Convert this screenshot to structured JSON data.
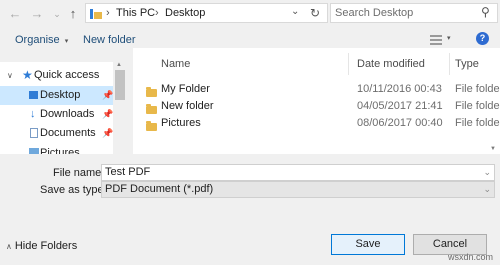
{
  "address": {
    "crumbs": [
      "This PC",
      "Desktop"
    ],
    "separator": "›",
    "search_placeholder": "Search Desktop"
  },
  "toolbar": {
    "organise_label": "Organise",
    "new_folder_label": "New folder"
  },
  "nav_pane": {
    "items": [
      {
        "label": "Quick access"
      },
      {
        "label": "Desktop"
      },
      {
        "label": "Downloads"
      },
      {
        "label": "Documents"
      },
      {
        "label": "Pictures"
      }
    ]
  },
  "file_list": {
    "columns": [
      "Name",
      "Date modified",
      "Type"
    ],
    "rows": [
      {
        "name": "My Folder",
        "date": "10/11/2016 00:43",
        "type": "File folder"
      },
      {
        "name": "New folder",
        "date": "04/05/2017 21:41",
        "type": "File folder"
      },
      {
        "name": "Pictures",
        "date": "08/06/2017 00:40",
        "type": "File folder"
      }
    ]
  },
  "form": {
    "file_name_label": "File name:",
    "file_name_value": "Test PDF",
    "save_type_label": "Save as type:",
    "save_type_value": "PDF Document (*.pdf)"
  },
  "footer": {
    "hide_folders_label": "Hide Folders",
    "save_label": "Save",
    "cancel_label": "Cancel",
    "watermark": "wsxdn.com"
  },
  "colors": {
    "accent": "#0078d7",
    "selection": "#cce8ff",
    "folder": "#e8b84a"
  }
}
